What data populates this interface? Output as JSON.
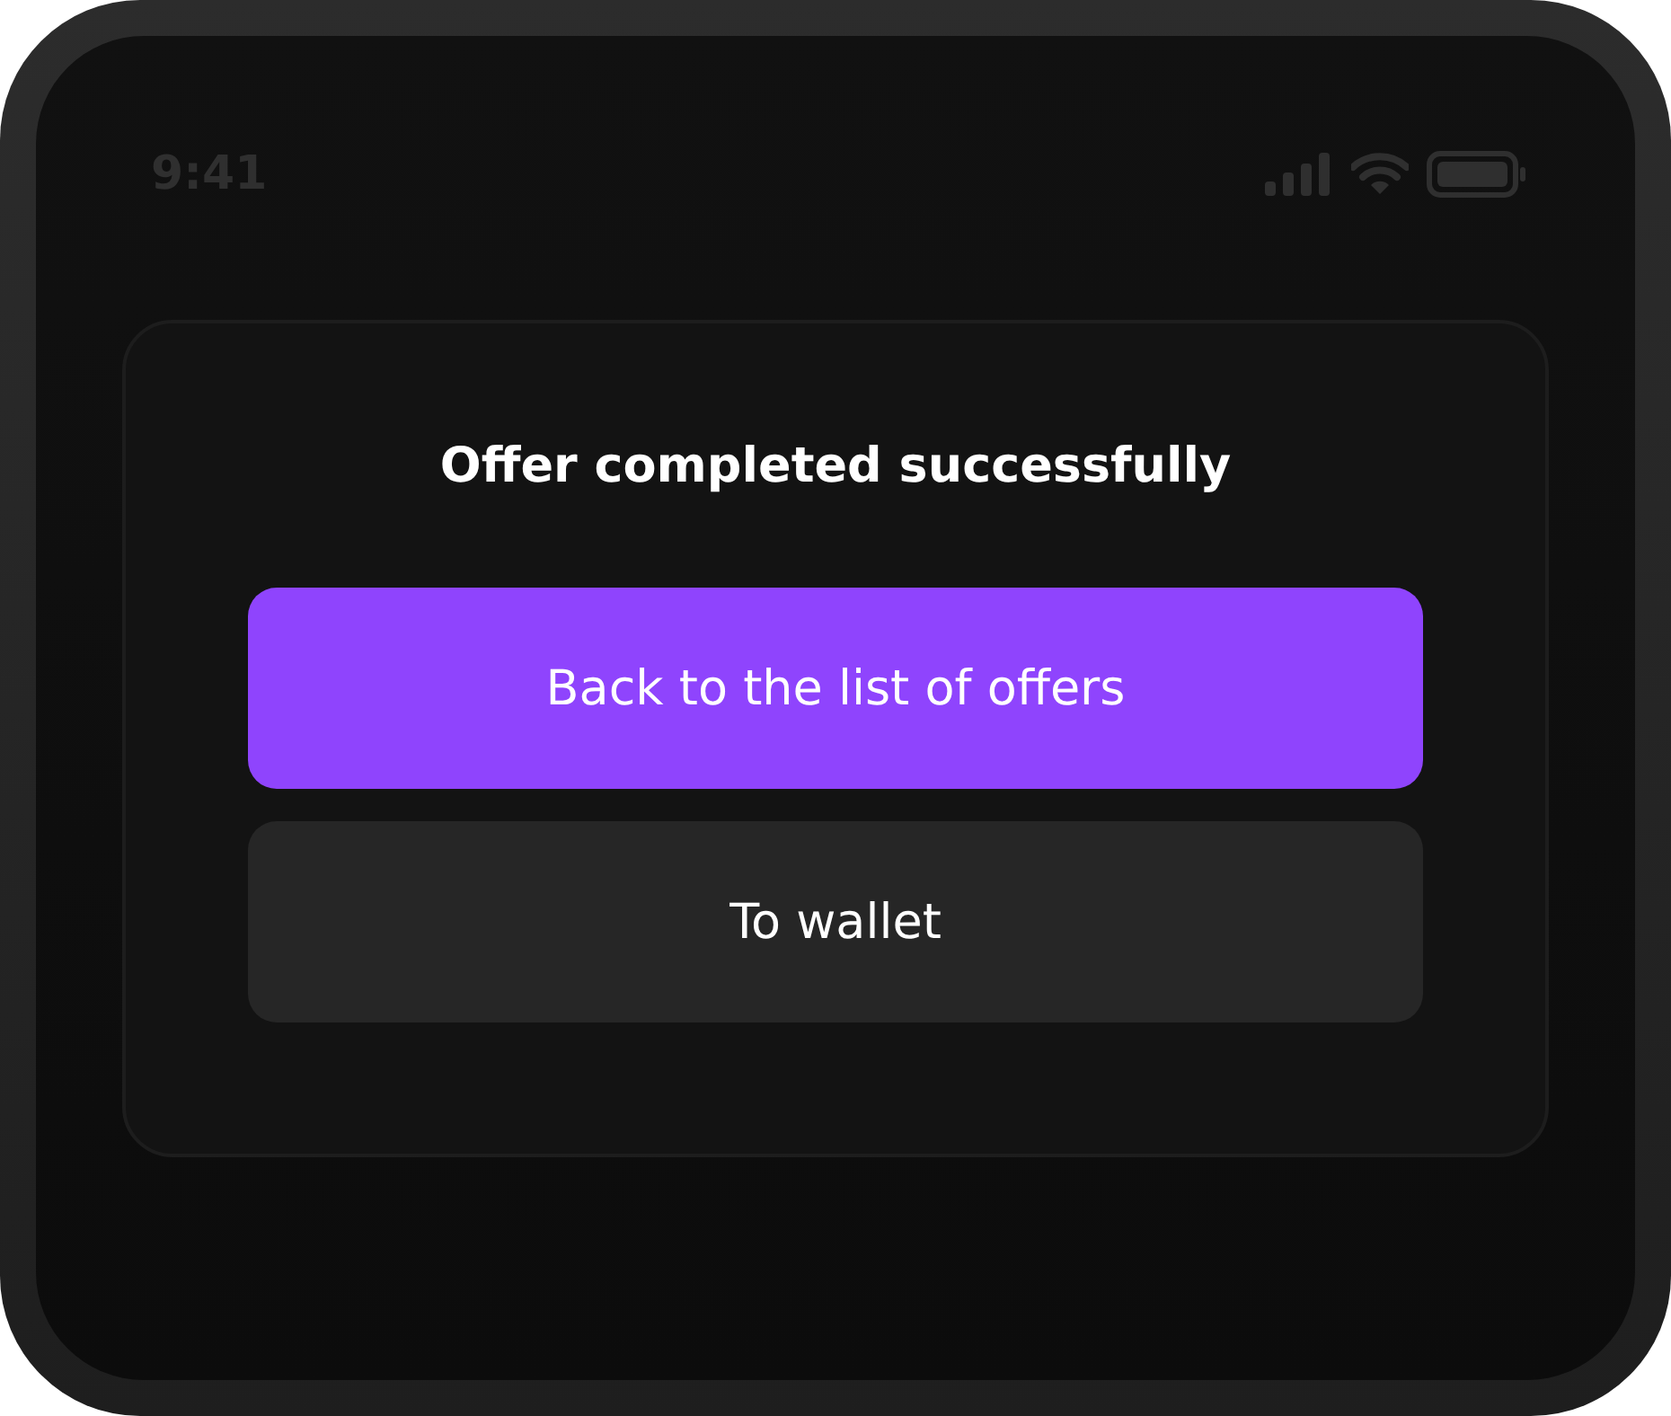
{
  "status_bar": {
    "time": "9:41"
  },
  "dialog": {
    "title": "Offer completed successfully",
    "buttons": [
      {
        "label": "Back to the list of offers",
        "kind": "primary"
      },
      {
        "label": "To wallet",
        "kind": "secondary"
      }
    ]
  }
}
